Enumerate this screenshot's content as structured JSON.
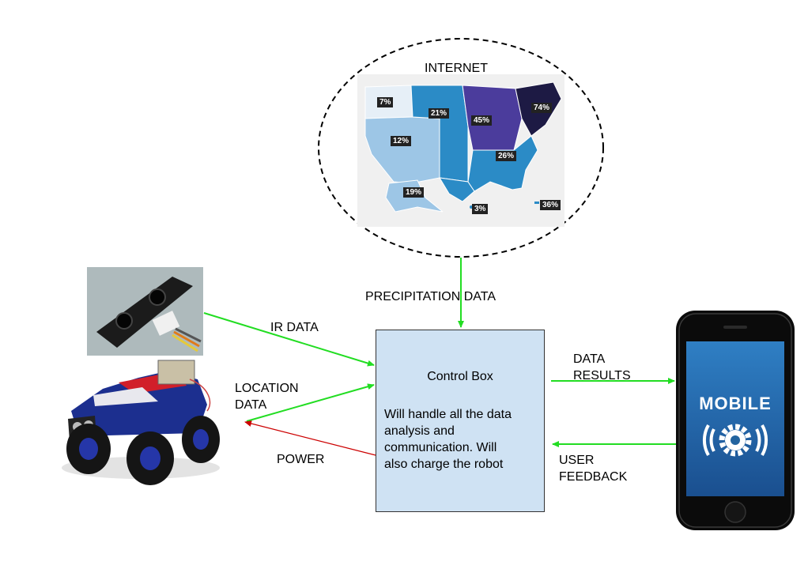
{
  "internet": {
    "label": "INTERNET",
    "map_labels": [
      "7%",
      "21%",
      "45%",
      "74%",
      "12%",
      "26%",
      "19%",
      "3%",
      "36%"
    ]
  },
  "edges": {
    "precipitation": "PRECIPITATION DATA",
    "ir_data": "IR DATA",
    "location_data_1": "LOCATION",
    "location_data_2": "DATA",
    "power": "POWER",
    "data_results_1": "DATA",
    "data_results_2": "RESULTS",
    "user_feedback_1": "USER",
    "user_feedback_2": "FEEDBACK"
  },
  "control_box": {
    "title": "Control Box",
    "desc_1": "Will handle all the data",
    "desc_2": "analysis and",
    "desc_3": "communication. Will",
    "desc_4": "also charge the robot"
  },
  "mobile": {
    "label": "MOBILE"
  },
  "colors": {
    "data_arrow": "#22dd22",
    "power_arrow": "#cc0000",
    "box_fill": "#cfe2f3"
  }
}
